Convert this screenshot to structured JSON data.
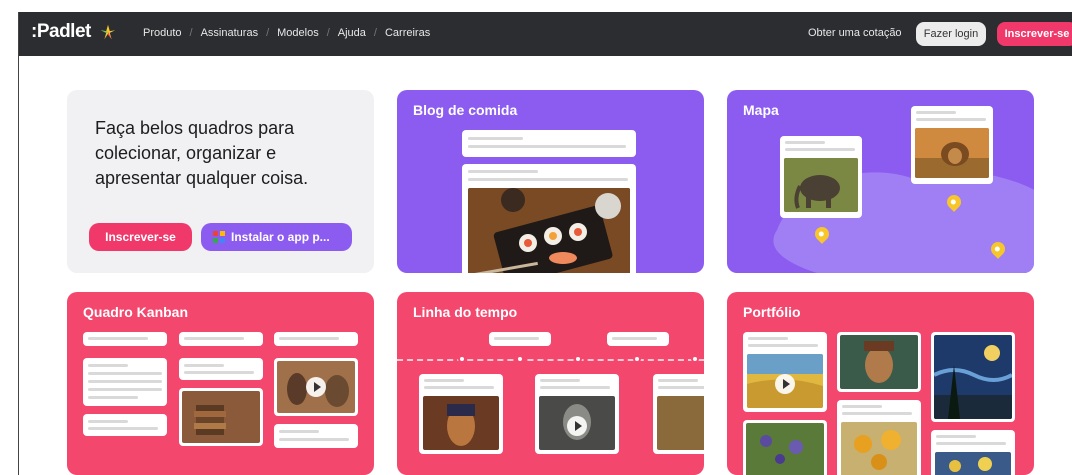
{
  "nav": {
    "logo": ":Padlet",
    "links": [
      "Produto",
      "Assinaturas",
      "Modelos",
      "Ajuda",
      "Carreiras"
    ],
    "quote": "Obter uma cotação",
    "login": "Fazer login",
    "signup": "Inscrever-se"
  },
  "hero": {
    "headline": "Faça belos quadros para colecionar, organizar e apresentar qualquer coisa.",
    "signup": "Inscrever-se",
    "install": "Instalar o app p..."
  },
  "cards": {
    "food_blog": "Blog de comida",
    "map": "Mapa",
    "kanban": "Quadro Kanban",
    "timeline": "Linha do tempo",
    "portfolio": "Portfólio"
  },
  "colors": {
    "purple": "#8c5cf0",
    "pink": "#f4476e",
    "nav_bg": "#2b2d31",
    "signup_pink": "#f0386b"
  }
}
